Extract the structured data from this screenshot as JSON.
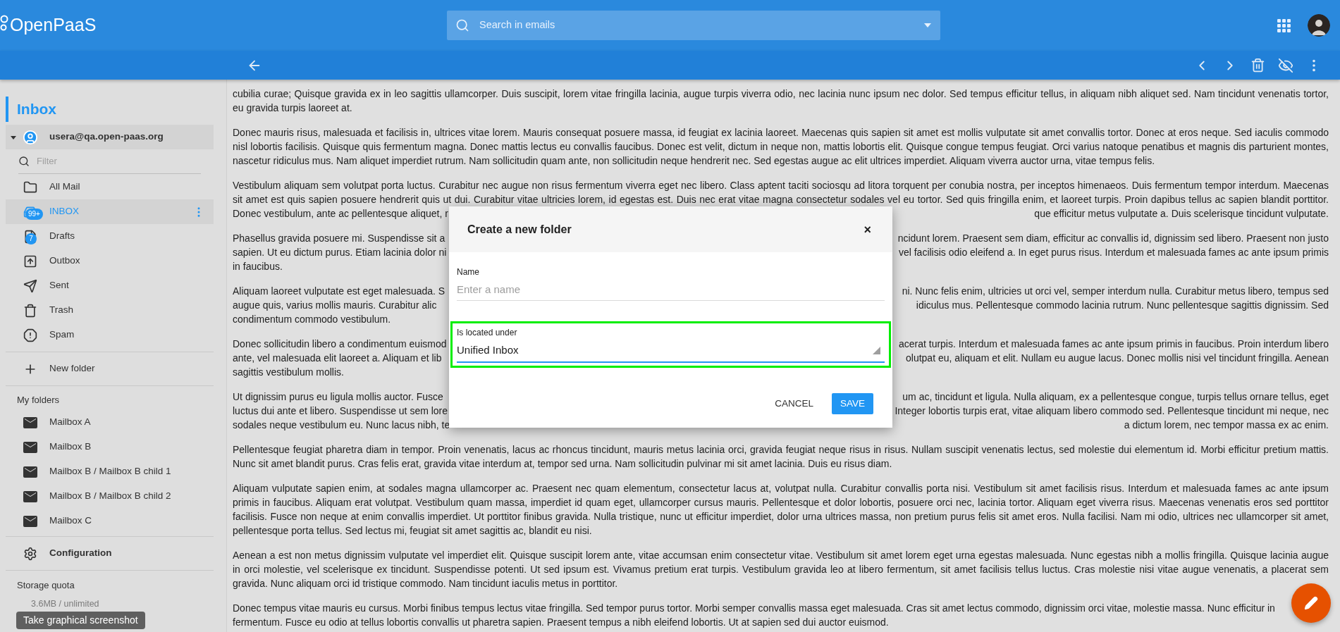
{
  "header": {
    "logo": "OpenPaaS",
    "search": {
      "placeholder": "Search in emails"
    }
  },
  "sidebar": {
    "title": "Inbox",
    "account": {
      "label": "usera@qa.open-paas.org",
      "expanded": true
    },
    "filter": {
      "placeholder": "Filter"
    },
    "mailboxes": [
      {
        "kind": "all",
        "label": "All Mail",
        "selected": false
      },
      {
        "kind": "inbox",
        "label": "INBOX",
        "badge": "99+",
        "selected": true
      },
      {
        "kind": "drafts",
        "label": "Drafts",
        "badge": "7",
        "selected": false
      },
      {
        "kind": "outbox",
        "label": "Outbox",
        "selected": false
      },
      {
        "kind": "sent",
        "label": "Sent",
        "selected": false
      },
      {
        "kind": "trash",
        "label": "Trash",
        "selected": false
      },
      {
        "kind": "spam",
        "label": "Spam",
        "selected": false
      }
    ],
    "new_folder": "New folder",
    "my_folders": {
      "title": "My folders",
      "items": [
        {
          "label": "Mailbox A",
          "selected": false
        },
        {
          "label": "Mailbox B",
          "selected": false
        },
        {
          "label": "Mailbox B / Mailbox B child 1",
          "selected": false
        },
        {
          "label": "Mailbox B / Mailbox B child 2",
          "selected": false
        },
        {
          "label": "Mailbox C",
          "selected": false
        }
      ]
    },
    "configuration": "Configuration",
    "storage": {
      "title": "Storage quota",
      "usage": "3.6MB / unlimited"
    }
  },
  "screenshot_button": "Take graphical screenshot",
  "message": {
    "paragraphs": [
      {
        "lines": [
          {
            "text": "cubilia curae; Quisque gravida ex in leo sagittis ullamcorper. Duis suscipit, lorem vitae fringilla lacinia, augue turpis viverra odio, nec lacinia nunc ipsum nec dolor. Sed tempus efficitur tellus, in aliquam nibh aliquet sed. Nam tincidunt venenatis tortor,"
          },
          {
            "text": "eu gravida turpis laoreet at."
          }
        ]
      },
      {
        "lines": [
          {
            "text": "Donec mauris risus, malesuada et facilisis in, ultrices vitae lorem. Mauris consequat posuere massa, id feugiat ex lacinia laoreet. Maecenas quis sapien sit amet est mollis vulputate sit amet convallis tortor. Donec at eros neque. Sed iaculis commodo"
          },
          {
            "text": "nisl lobortis facilisis. Quisque quis fermentum magna. Donec mattis lectus eu convallis faucibus. Donec est velit, dictum in neque non, mattis lobortis elit. Quisque congue tempus feugiat. Orci varius natoque penatibus et magnis dis parturient montes,"
          },
          {
            "text": "nascetur ridiculus mus. Nam aliquet imperdiet rutrum. Nam sollicitudin quam ante, non sollicitudin neque hendrerit nec. Sed egestas augue ac elit ultrices imperdiet. Aliquam viverra auctor urna, vitae tempus felis."
          }
        ]
      },
      {
        "lines": [
          {
            "text": "Vestibulum aliquam sem volutpat porta luctus. Curabitur nec augue non risus fermentum viverra eget nec libero. Class aptent taciti sociosqu ad litora torquent per conubia nostra, per inceptos himenaeos. Duis fermentum tempor interdum. Maecenas"
          },
          {
            "text": "sit amet est quis sapien posuere hendrerit quis ut dui. Curabitur vitae ultricies lorem, id egestas est. Duis nec erat vitae magna consectetur sodales vel eu tortor. Sed quis fringilla enim, et laoreet turpis. Proin dapibus tellus ac sapien blandit porttitor."
          },
          {
            "left": "Donec vestibulum, ante ac pellentesque aliquet, r",
            "right": "que efficitur metus vulputate a. Duis scelerisque tincidunt vulputate."
          }
        ]
      },
      {
        "lines": [
          {
            "left": "Phasellus gravida posuere mi. Suspendisse sit a",
            "right": "ncidunt lorem. Praesent sem diam, efficitur ac convallis id, dignissim sed libero. Praesent non justo"
          },
          {
            "left": "sapien. Ut eu dictum purus. Etiam lacinia dolor ni",
            "right": "vel facilisis odio eleifend a. In eget purus risus. Interdum et malesuada fames ac ante ipsum primis"
          },
          {
            "text": "in faucibus."
          }
        ]
      },
      {
        "lines": [
          {
            "left": "Aliquam laoreet vulputate est eget malesuada. S",
            "right": "ni. Nunc felis enim, ultricies ut orci vel, semper interdum nulla. Curabitur metus libero, tempus sed"
          },
          {
            "left": "augue quis, varius mollis mauris. Curabitur alic",
            "right": "idiculus mus. Pellentesque commodo lacinia rutrum. Nunc pellentesque sagittis dignissim. Sed"
          },
          {
            "text": "condimentum commodo vestibulum."
          }
        ]
      },
      {
        "lines": [
          {
            "left": "Donec sollicitudin libero a condimentum euismod",
            "right": "acerat turpis. Interdum et malesuada fames ac ante ipsum primis in faucibus. Proin interdum libero"
          },
          {
            "left": "ante, vel malesuada elit laoreet a. Aliquam et lib",
            "right": "olutpat eu, aliquam et elit. Nullam eu augue lacus. Donec mollis nisi vel tincidunt fringilla. Aenean"
          },
          {
            "text": "sagittis vestibulum mollis."
          }
        ]
      },
      {
        "lines": [
          {
            "left": "Ut dignissim purus eu ligula mollis auctor. Fusce",
            "right": "um ac, tincidunt et ligula. Nulla aliquam, ex a pellentesque congue, turpis tellus ornare tellus, eget"
          },
          {
            "left": "luctus dui ante et libero. Suspendisse ut sem lore",
            "right": "Integer lobortis turpis erat, vitae aliquam libero commodo sed. Pellentesque tincidunt mi neque, nec"
          },
          {
            "left": "sodales neque vestibulum eu. Nunc lacus nibh, te",
            "right": "a dictum lorem, nec tempor massa ex ac enim."
          }
        ]
      },
      {
        "lines": [
          {
            "text": "Pellentesque feugiat pharetra diam in tempor. Proin venenatis, lacus ac rhoncus tincidunt, mauris metus lacinia orci, gravida feugiat neque risus in risus. Nullam suscipit venenatis lectus, sed molestie dui elementum id. Morbi efficitur pretium mattis."
          },
          {
            "text": "Nunc sit amet blandit purus. Cras felis erat, gravida vitae interdum at, tempor sed urna. Nam sollicitudin pulvinar mi sit amet lacinia. Duis eu risus diam."
          }
        ]
      },
      {
        "lines": [
          {
            "text": "Aliquam vulputate sapien enim, at sodales magna ullamcorper ac. Praesent nec quam elementum, consectetur lacus at, volutpat nulla. Curabitur convallis porta nisi. Vestibulum sit amet facilisis risus. Interdum et malesuada fames ac ante ipsum"
          },
          {
            "text": "primis in faucibus. Aliquam erat volutpat. Vestibulum quam massa, imperdiet id quam eget, ullamcorper cursus mauris. Pellentesque et dolor lobortis, posuere orci nec, lacinia tortor. Aliquam eget viverra risus. Maecenas venenatis eros sed porttitor"
          },
          {
            "text": "facilisis. Fusce non neque at enim convallis imperdiet. Ut porttitor finibus gravida. Nulla tristique, nunc ut efficitur imperdiet, dolor urna ultrices massa, non pretium purus felis sit amet eros. Nulla facilisi. Nam mi odio, ultrices nec ullamcorper sit amet,"
          },
          {
            "text": "pellentesque porta tellus. Sed lectus mi, feugiat sit amet sagittis ac, blandit eu nisi."
          }
        ]
      },
      {
        "lines": [
          {
            "text": "Aenean a est non metus dignissim vulputate vel imperdiet elit. Quisque suscipit lorem ante, vitae accumsan enim consectetur vitae. Vestibulum sit amet lorem eget urna egestas malesuada. Nunc egestas nibh a mollis fringilla. Quisque lacinia augue"
          },
          {
            "text": "in orci molestie, vel scelerisque ex tincidunt. Suspendisse potenti. Ut sed ipsum est. Vivamus pretium erat turpis. Vestibulum gravida leo at libero fermentum, sit amet facilisis tellus luctus. Cras molestie nisi vitae augue venenatis, a placerat sem"
          },
          {
            "text": "gravida. Nunc aliquam orci id tristique commodo. Nam tincidunt iaculis metus in porttitor."
          }
        ]
      },
      {
        "lines": [
          {
            "left": "Donec tempus vitae mauris eu cursus. Morbi finibus tempus lectus vitae fringilla. Sed tempor purus tortor. Morbi semper convallis massa eget malesuada. Cras sit amet lectus commodo, dignissim orci vitae, molestie massa. Nunc efficitur in"
          },
          {
            "text": "fermentum. Fusce eu odio at tellus lobortis convallis ut pharetra sapien. Praesent tempus a nibh eleifend lobortis. Ut at sapien sed dui auctor euismod."
          }
        ]
      }
    ]
  },
  "dialog": {
    "title": "Create a new folder",
    "close": "×",
    "fields": [
      {
        "kind": "text",
        "label": "Name",
        "placeholder": "Enter a name",
        "highlighted": false
      },
      {
        "kind": "select",
        "label": "Is located under",
        "value": "Unified Inbox",
        "highlighted": true
      }
    ],
    "buttons": [
      {
        "kind": "flat",
        "label": "CANCEL"
      },
      {
        "kind": "primary",
        "label": "SAVE"
      }
    ]
  }
}
